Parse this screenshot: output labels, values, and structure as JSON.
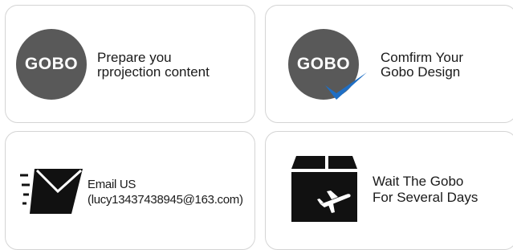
{
  "steps": [
    {
      "logo_text": "GOBO",
      "line1": "Prepare you",
      "line2": "rprojection content",
      "icon": "gobo-logo-icon"
    },
    {
      "logo_text": "GOBO",
      "line1": "Comfirm Your",
      "line2": "Gobo Design",
      "icon": "checkmark-icon"
    },
    {
      "line1": "Email US",
      "line2": "(lucy13437438945@163.com)",
      "icon": "envelope-icon"
    },
    {
      "line1": "Wait The Gobo",
      "line2": "For Several Days",
      "icon": "air-shipping-box-icon"
    }
  ],
  "colors": {
    "logo_circle": "#595959",
    "check": "#1f6fc5",
    "icon_dark": "#111111",
    "card_border": "#d4d4d4"
  }
}
